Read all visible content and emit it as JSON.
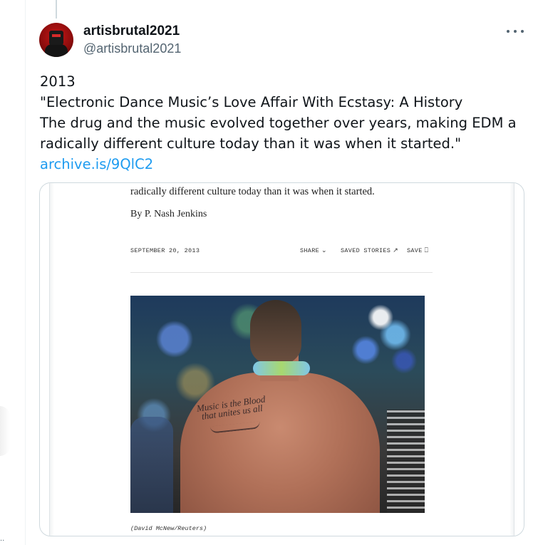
{
  "tweet": {
    "author": {
      "display_name": "artisbrutal2021",
      "handle": "@artisbrutal2021",
      "avatar_icon": "avatar-image"
    },
    "more_icon": "more-horizontal-icon",
    "text_lines": [
      "2013",
      "\"Electronic Dance Music’s Love Affair With Ecstasy: A History",
      "The drug and the music evolved together over years, making EDM a",
      "radically different culture today than it was when it started.\""
    ],
    "link": "archive.is/9QlC2",
    "link_color": "#1d9bf0"
  },
  "media": {
    "dek": "radically different culture today than it was when it started.",
    "byline": "By P. Nash Jenkins",
    "date": "SEPTEMBER 20, 2013",
    "share_label": "SHARE",
    "share_icon": "chevron-down-icon",
    "saved_stories_label": "SAVED STORIES",
    "saved_stories_icon": "arrow-up-right-icon",
    "save_label": "SAVE",
    "save_icon": "bookmark-icon",
    "photo_tattoo_text": "Music is the Blood that unites us all",
    "photo_caption": "(David McNew/Reuters)"
  }
}
